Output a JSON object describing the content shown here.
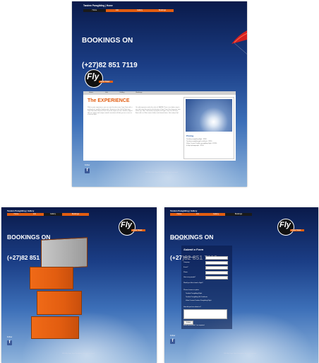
{
  "site": {
    "breadcrumb_home": "Tandem Paragliding | Home",
    "breadcrumb_gallery": "Tandem Paragliding | Gallery",
    "breadcrumb_contact": "Tandem Paragliding | Gallery",
    "bookings_line1": "BOOKINGS ON",
    "bookings_line2": "(+27)82 851 7119",
    "logo_text": "Fly",
    "logo_sub": "Cape Town",
    "footer": "2013 Fly Cape Town Paragliding. All rights reserved.",
    "facebook_icon_letter": "f",
    "social_label": "Follow"
  },
  "nav": {
    "items": [
      "Home",
      "Info",
      "Gallery",
      "Bookings"
    ]
  },
  "home": {
    "tabs": [
      "Home",
      "Info",
      "Gallery",
      "Bookings"
    ],
    "heading": "The EXPERIENCE",
    "col1": "With no prior experience, you can soar the skies over Cape Town with a professional, qualified tandem pilot. Experience the thrill of flight over Table Mountain National Park. From the slopes of Lion's Head or Signal Hill, our unique and unique smooth sensation will take you on a once in a lifetime flight.",
    "col2": "Our pilot operates under the rules of SAHPA. There is no better way to see and enjoy the spectacular beauty of Cape Town than from your own 'bird's eye' view. Thousands of people of all ages, from 4 to 80 have flown with us. Wear warm clothes and closed shoes. Get ready to fly!",
    "pricing_title": "Pricing",
    "prices": [
      "Tandem paragliding flight - R950",
      "Tandem paragliding gift certificate - R950",
      "Video Camera Tandem paragliding flight - R1250",
      "In flight photographs - R150"
    ]
  },
  "contact": {
    "contact_block": "CONTACT DETAILS\nEmail: info@flycapetown.co.za",
    "form_title": "Submit a Form",
    "fields": [
      "Name & Surname *",
      "Company",
      "E-mail *",
      "Phone",
      "How many people?",
      "Would you like to book a flight?",
      "Please choose an option",
      "How did you hear about us?"
    ],
    "options": [
      "Tandem Paragliding Flight",
      "Tandem Paragliding Gift Certificate",
      "Video Camera Tandem Paragliding Flight"
    ],
    "submit": "Submit",
    "required_note": "Fields marked with * are required."
  },
  "colors": {
    "accent": "#e25d10",
    "sky_dark": "#0a1a4a",
    "facebook": "#3b5998"
  }
}
